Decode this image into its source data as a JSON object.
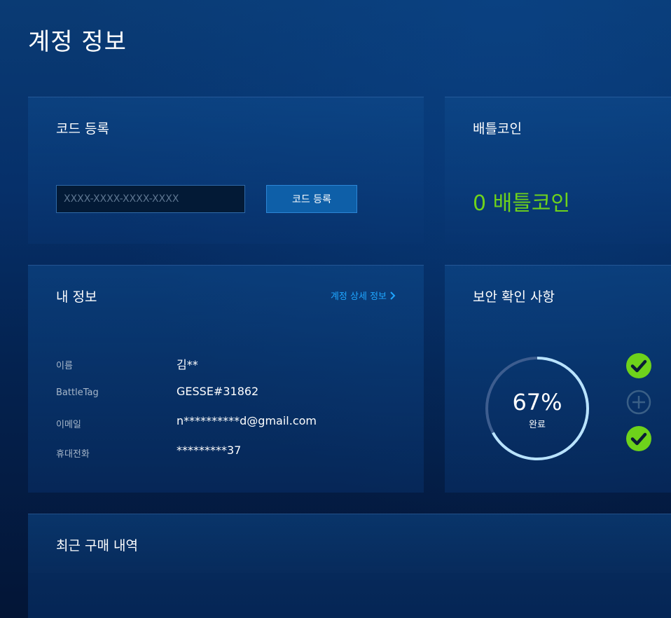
{
  "page": {
    "title": "계정 정보"
  },
  "code_panel": {
    "title": "코드 등록",
    "input_placeholder": "XXXX-XXXX-XXXX-XXXX",
    "button_label": "코드 등록"
  },
  "battlecoin_panel": {
    "title": "배틀코인",
    "amount": "0 배틀코인",
    "amount_color": "#6ed21b"
  },
  "info_panel": {
    "title": "내 정보",
    "detail_link": "계정 상세 정보",
    "detail_link_icon": "chevron-right-icon",
    "rows": [
      {
        "label": "이름",
        "value": "김**"
      },
      {
        "label": "BattleTag",
        "value": "GESSE#31862"
      },
      {
        "label": "이메일",
        "value": "n**********d@gmail.com"
      },
      {
        "label": "휴대전화",
        "value": "*********37"
      }
    ]
  },
  "security_panel": {
    "title": "보안 확인 사항",
    "progress_fraction": 0.67,
    "percent_text": "67%",
    "percent_label": "완료",
    "statuses": [
      {
        "state": "complete",
        "icon": "check-circle-icon",
        "color": "#6ed21b"
      },
      {
        "state": "pending",
        "icon": "plus-circle-icon",
        "color": "#3a5f86"
      },
      {
        "state": "complete",
        "icon": "check-circle-icon",
        "color": "#6ed21b"
      }
    ]
  },
  "purchase_panel": {
    "title": "최근 구매 내역"
  }
}
